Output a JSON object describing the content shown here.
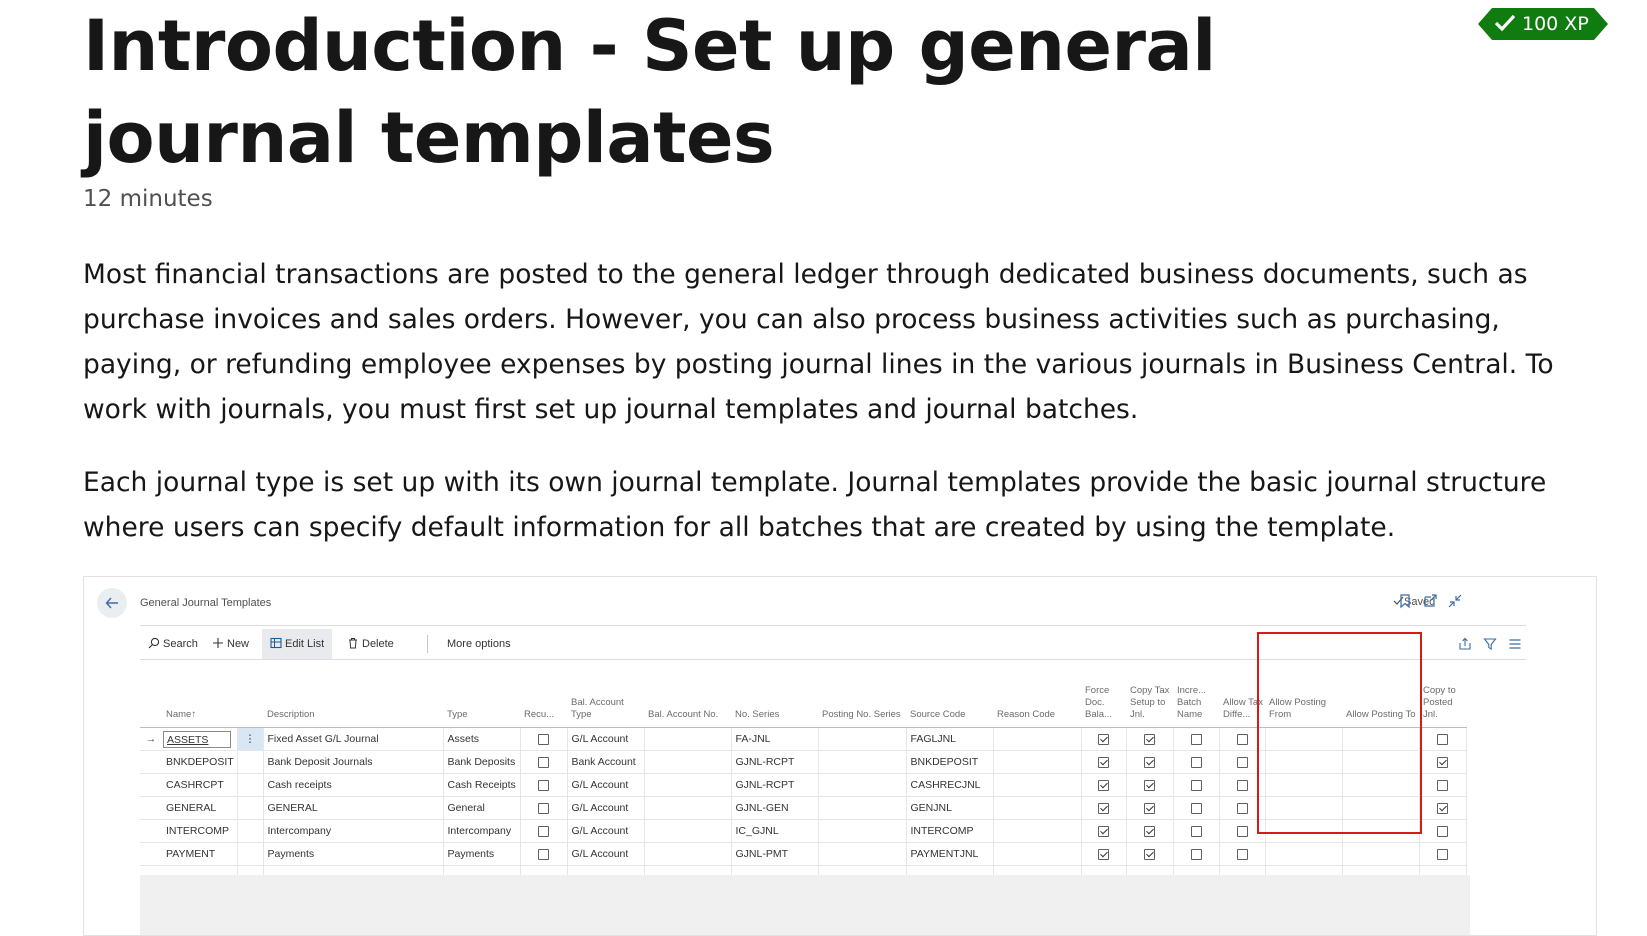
{
  "header": {
    "title": "Introduction - Set up general journal templates",
    "duration": "12 minutes",
    "xp": "100 XP"
  },
  "paragraphs": [
    "Most financial transactions are posted to the general ledger through dedicated business documents, such as purchase invoices and sales orders. However, you can also process business activities such as purchasing, paying, or refunding employee expenses by posting journal lines in the various journals in Business Central. To work with journals, you must first set up journal templates and journal batches.",
    "Each journal type is set up with its own journal template. Journal templates provide the basic journal structure where users can specify default information for all batches that are created by using the template."
  ],
  "screenshot": {
    "page_name": "General Journal Templates",
    "saved": "Saved",
    "actions": {
      "search": "Search",
      "new": "New",
      "edit_list": "Edit List",
      "delete": "Delete",
      "more": "More options"
    },
    "columns": [
      "Name",
      "Description",
      "Type",
      "Recu...",
      "Bal. Account Type",
      "Bal. Account No.",
      "No. Series",
      "Posting No. Series",
      "Source Code",
      "Reason Code",
      "Force Doc. Bala...",
      "Copy Tax Setup to Jnl.",
      "Incre... Batch Name",
      "Allow Tax Diffe...",
      "Allow Posting From",
      "Allow Posting To",
      "Copy to Posted Jnl."
    ],
    "name_sort_arrow": "↑",
    "rows": [
      {
        "name": "ASSETS",
        "description": "Fixed Asset G/L Journal",
        "type": "Assets",
        "bal_type": "G/L Account",
        "no_series": "FA-JNL",
        "source_code": "FAGLJNL",
        "recurring": false,
        "force": true,
        "copy_tax": true,
        "incr": false,
        "allow_tax": false,
        "copy_posted": false
      },
      {
        "name": "BNKDEPOSIT",
        "description": "Bank Deposit Journals",
        "type": "Bank Deposits",
        "bal_type": "Bank Account",
        "no_series": "GJNL-RCPT",
        "source_code": "BNKDEPOSIT",
        "recurring": false,
        "force": true,
        "copy_tax": true,
        "incr": false,
        "allow_tax": false,
        "copy_posted": true
      },
      {
        "name": "CASHRCPT",
        "description": "Cash receipts",
        "type": "Cash Receipts",
        "bal_type": "G/L Account",
        "no_series": "GJNL-RCPT",
        "source_code": "CASHRECJNL",
        "recurring": false,
        "force": true,
        "copy_tax": true,
        "incr": false,
        "allow_tax": false,
        "copy_posted": false
      },
      {
        "name": "GENERAL",
        "description": "GENERAL",
        "type": "General",
        "bal_type": "G/L Account",
        "no_series": "GJNL-GEN",
        "source_code": "GENJNL",
        "recurring": false,
        "force": true,
        "copy_tax": true,
        "incr": false,
        "allow_tax": false,
        "copy_posted": true
      },
      {
        "name": "INTERCOMP",
        "description": "Intercompany",
        "type": "Intercompany",
        "bal_type": "G/L Account",
        "no_series": "IC_GJNL",
        "source_code": "INTERCOMP",
        "recurring": false,
        "force": true,
        "copy_tax": true,
        "incr": false,
        "allow_tax": false,
        "copy_posted": false
      },
      {
        "name": "PAYMENT",
        "description": "Payments",
        "type": "Payments",
        "bal_type": "G/L Account",
        "no_series": "GJNL-PMT",
        "source_code": "PAYMENTJNL",
        "recurring": false,
        "force": true,
        "copy_tax": true,
        "incr": false,
        "allow_tax": false,
        "copy_posted": false
      }
    ]
  },
  "colors": {
    "xp_badge": "#107c10",
    "highlight_box": "#d61a1a",
    "text": "#171717"
  }
}
